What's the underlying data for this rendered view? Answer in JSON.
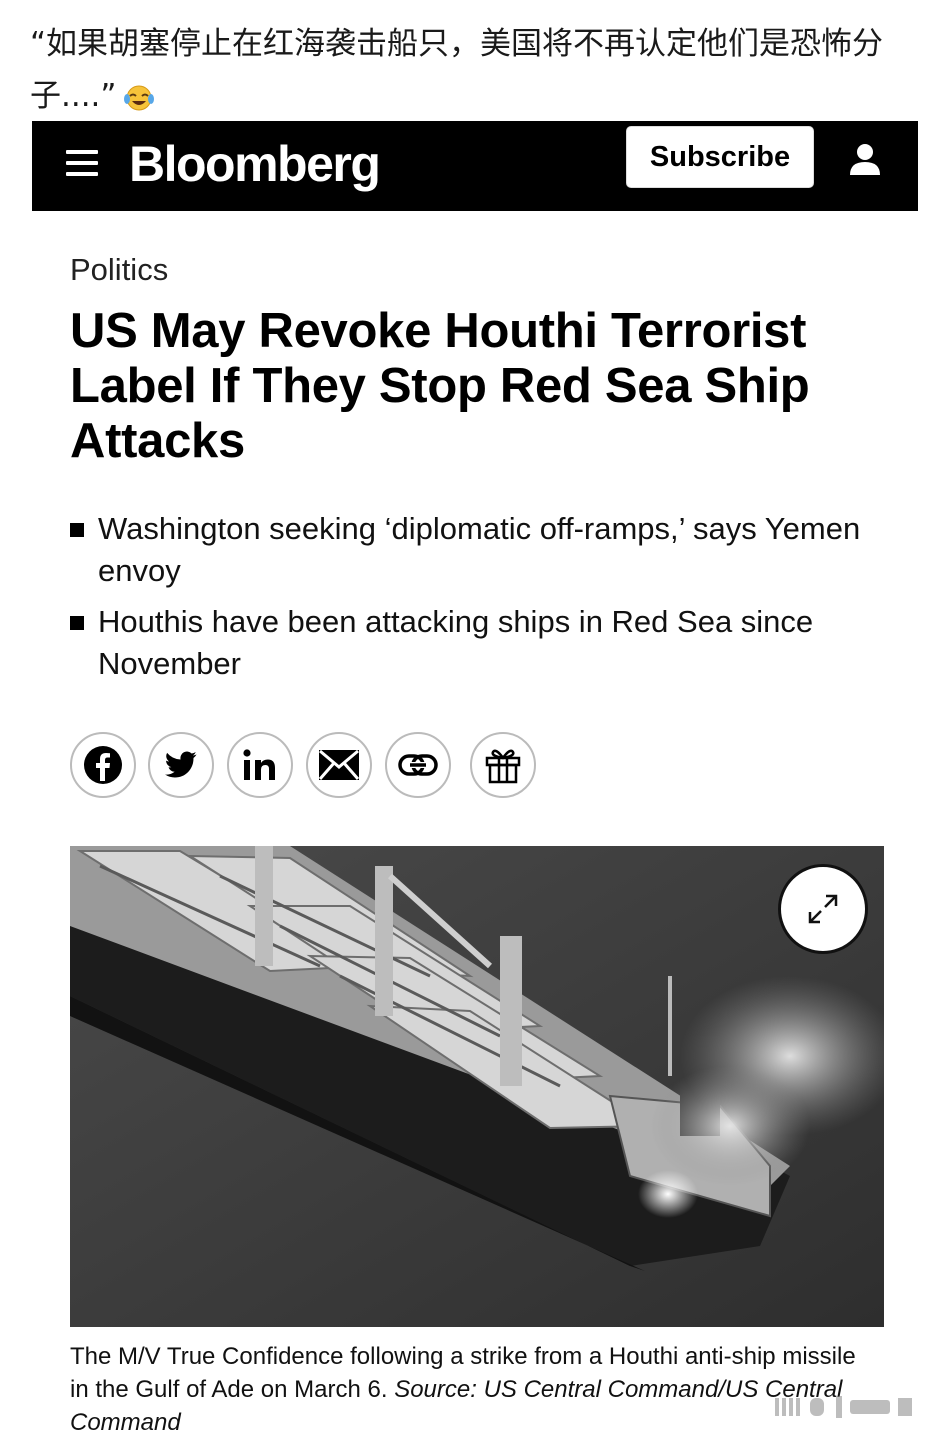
{
  "post": {
    "text": "“如果胡塞停止在红海袭击船只，美国将不再认定他们是恐怖分子....”",
    "emoji": "laughing-crying-emoji"
  },
  "header": {
    "brand": "Bloomberg",
    "subscribe_label": "Subscribe",
    "background_color": "#000000"
  },
  "article": {
    "category": "Politics",
    "headline": "US May Revoke Houthi Terrorist Label If They Stop Red Sea Ship Attacks",
    "bullets": [
      "Washington seeking ‘diplomatic off-ramps,’ says Yemen envoy",
      "Houthis have been attacking ships in Red Sea since November"
    ],
    "share_icons": [
      "facebook-icon",
      "twitter-icon",
      "linkedin-icon",
      "email-icon",
      "link-icon",
      "gift-icon"
    ],
    "image": {
      "caption": "The M/V True Confidence following a strike from a Houthi anti-ship missile in the Gulf of Ade on March 6.",
      "source": "Source: US Central Command/US Central Command"
    }
  }
}
